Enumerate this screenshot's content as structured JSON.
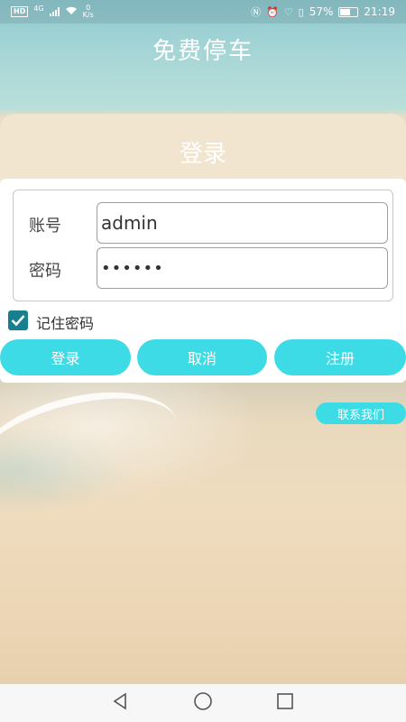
{
  "status_bar": {
    "network_badge": "HD",
    "network_type": "4G",
    "speed_value": "0",
    "speed_unit": "K/s",
    "battery_percent": "57%",
    "time": "21:19"
  },
  "app": {
    "title": "免费停车"
  },
  "login_card": {
    "title": "登录",
    "account_label": "账号",
    "account_value": "admin",
    "password_label": "密码",
    "password_value": "••••••",
    "remember_checked": true,
    "remember_label": "记住密码"
  },
  "buttons": {
    "login": "登录",
    "cancel": "取消",
    "register": "注册",
    "contact": "联系我们"
  },
  "colors": {
    "accent": "#3ddbe6",
    "checkbox": "#177f8e"
  },
  "icons": {
    "back": "back-triangle-icon",
    "home": "home-circle-icon",
    "recent": "recent-square-icon"
  }
}
